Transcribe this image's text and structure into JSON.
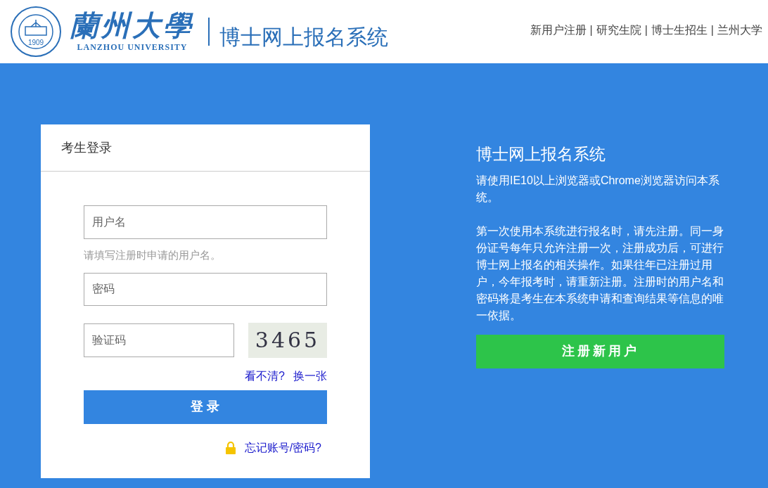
{
  "header": {
    "logo_name": "蘭州大學",
    "logo_english": "LANZHOU UNIVERSITY",
    "seal_year": "1909",
    "system_title": "博士网上报名系统",
    "nav_links": [
      {
        "label": "新用户注册"
      },
      {
        "label": "研究生院"
      },
      {
        "label": "博士生招生"
      },
      {
        "label": "兰州大学"
      }
    ],
    "nav_separator": "|"
  },
  "login": {
    "title": "考生登录",
    "username": {
      "placeholder": "用户名"
    },
    "username_hint": "请填写注册时申请的用户名。",
    "password": {
      "placeholder": "密码"
    },
    "captcha": {
      "placeholder": "验证码"
    },
    "captcha_image": "3465",
    "captcha_links": [
      "看不清?",
      "换一张"
    ],
    "submit": "登 录",
    "forgot": "忘记账号/密码?"
  },
  "info": {
    "title": "博士网上报名系统",
    "paragraphs": [
      "请使用IE10以上浏览器或Chrome浏览器访问本系统。",
      "第一次使用本系统进行报名时，请先注册。同一身份证号每年只允许注册一次，注册成功后，可进行博士网上报名的相关操作。如果往年已注册过用户，今年报考时，请重新注册。注册时的用户名和密码将是考生在本系统申请和查询结果等信息的唯一依据。"
    ],
    "register_button": "注册新用户"
  }
}
